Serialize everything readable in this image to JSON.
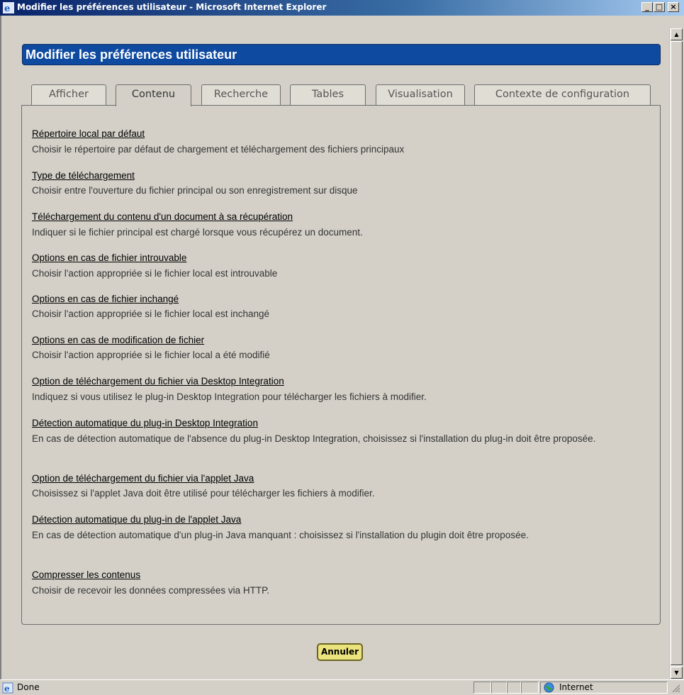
{
  "window": {
    "title": "Modifier les préférences utilisateur - Microsoft Internet Explorer",
    "minimize": "_",
    "maximize": "□",
    "close": "×"
  },
  "page": {
    "heading": "Modifier les préférences utilisateur",
    "tabs": [
      {
        "label": "Afficher",
        "active": false
      },
      {
        "label": "Contenu",
        "active": true
      },
      {
        "label": "Recherche",
        "active": false
      },
      {
        "label": "Tables",
        "active": false
      },
      {
        "label": "Visualisation",
        "active": false
      },
      {
        "label": "Contexte de configuration",
        "active": false
      }
    ],
    "items": [
      {
        "title": "Répertoire local par défaut",
        "description": "Choisir le répertoire par défaut de chargement et téléchargement des fichiers principaux"
      },
      {
        "title": "Type de téléchargement",
        "description": "Choisir entre l'ouverture du fichier principal ou son enregistrement sur disque"
      },
      {
        "title": "Téléchargement du contenu d'un document à sa récupération",
        "description": "Indiquer si le fichier principal est chargé lorsque vous récupérez un document."
      },
      {
        "title": "Options en cas de fichier introuvable",
        "description": "Choisir l'action appropriée si le fichier local est introuvable"
      },
      {
        "title": "Options en cas de fichier inchangé",
        "description": "Choisir l'action appropriée si le fichier local est inchangé"
      },
      {
        "title": "Options en cas de modification de fichier",
        "description": "Choisir l'action appropriée si le fichier local a été modifié"
      },
      {
        "title": "Option de téléchargement du fichier via Desktop Integration",
        "description": "Indiquez si vous utilisez le plug-in Desktop Integration pour télécharger les fichiers à modifier."
      },
      {
        "title": "Détection automatique du plug-in Desktop Integration",
        "description": "En cas de détection automatique de l'absence du plug-in Desktop Integration, choisissez si l'installation du plug-in doit être proposée."
      },
      {
        "title": "Option de téléchargement du fichier via l'applet Java",
        "description": "Choisissez si l'applet Java doit être utilisé pour télécharger les fichiers à modifier."
      },
      {
        "title": "Détection automatique du plug-in de l'applet Java",
        "description": "En cas de détection automatique d'un plug-in Java manquant : choisissez si l'installation du plugin doit être proposée."
      },
      {
        "title": "Compresser les contenus",
        "description": "Choisir de recevoir les données compressées via HTTP."
      }
    ],
    "cancel_label": "Annuler"
  },
  "statusbar": {
    "status": "Done",
    "zone": "Internet"
  },
  "icons": {
    "ie": "ie-icon",
    "globe": "globe-icon",
    "scroll_up": "▲",
    "scroll_down": "▼"
  }
}
